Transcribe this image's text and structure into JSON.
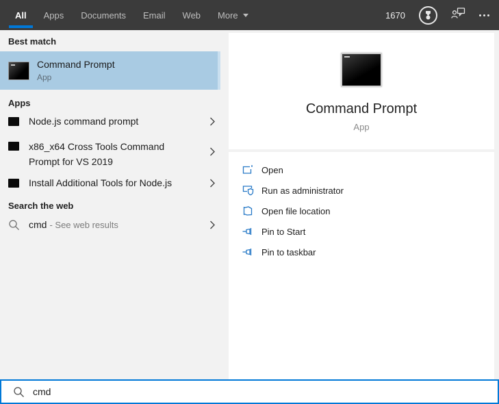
{
  "colors": {
    "accent": "#0078d7",
    "topbar_bg": "#3b3b3b",
    "panel_bg": "#f2f2f2",
    "highlight": "#a9cbe3",
    "action_icon_blue": "#2779c7"
  },
  "topbar": {
    "tabs": [
      {
        "label": "All",
        "active": true
      },
      {
        "label": "Apps",
        "active": false
      },
      {
        "label": "Documents",
        "active": false
      },
      {
        "label": "Email",
        "active": false
      },
      {
        "label": "Web",
        "active": false
      },
      {
        "label": "More",
        "active": false,
        "has_dropdown": true
      }
    ],
    "rewards_points": "1670",
    "icons": [
      "medal-icon",
      "feedback-icon",
      "ellipsis-icon"
    ]
  },
  "left_panel": {
    "best_match_header": "Best match",
    "best_match": {
      "title": "Command Prompt",
      "subtitle": "App",
      "icon": "command-prompt-icon"
    },
    "apps_header": "Apps",
    "apps": [
      {
        "label": "Node.js command prompt",
        "icon": "terminal-icon"
      },
      {
        "label": "x86_x64 Cross Tools Command Prompt for VS 2019",
        "icon": "terminal-icon"
      },
      {
        "label": "Install Additional Tools for Node.js",
        "icon": "terminal-icon"
      }
    ],
    "web_header": "Search the web",
    "web_item": {
      "query": "cmd",
      "suffix": "- See web results",
      "icon": "magnifier-icon"
    }
  },
  "right_panel": {
    "title": "Command Prompt",
    "subtitle": "App",
    "icon": "command-prompt-icon",
    "actions": [
      {
        "label": "Open",
        "icon": "open-window-icon"
      },
      {
        "label": "Run as administrator",
        "icon": "shield-window-icon"
      },
      {
        "label": "Open file location",
        "icon": "folder-icon"
      },
      {
        "label": "Pin to Start",
        "icon": "pin-icon"
      },
      {
        "label": "Pin to taskbar",
        "icon": "pin-icon"
      }
    ]
  },
  "search_bar": {
    "value": "cmd",
    "icon": "magnifier-icon"
  }
}
